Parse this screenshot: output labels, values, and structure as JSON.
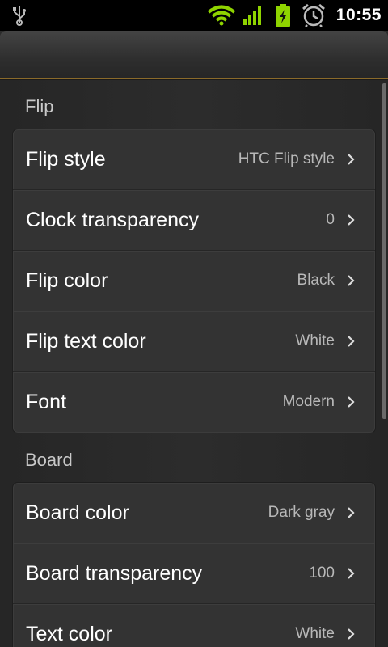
{
  "status_bar": {
    "time": "10:55",
    "icons": [
      "usb-icon",
      "wifi-icon",
      "signal-icon",
      "battery-charging-icon",
      "alarm-icon"
    ],
    "accent_color": "#8fd400"
  },
  "sections": [
    {
      "title": "Flip",
      "items": [
        {
          "label": "Flip style",
          "value": "HTC Flip style"
        },
        {
          "label": "Clock transparency",
          "value": "0"
        },
        {
          "label": "Flip color",
          "value": "Black"
        },
        {
          "label": "Flip text color",
          "value": "White"
        },
        {
          "label": "Font",
          "value": "Modern"
        }
      ]
    },
    {
      "title": "Board",
      "items": [
        {
          "label": "Board color",
          "value": "Dark gray"
        },
        {
          "label": "Board transparency",
          "value": "100"
        },
        {
          "label": "Text color",
          "value": "White"
        }
      ]
    }
  ]
}
